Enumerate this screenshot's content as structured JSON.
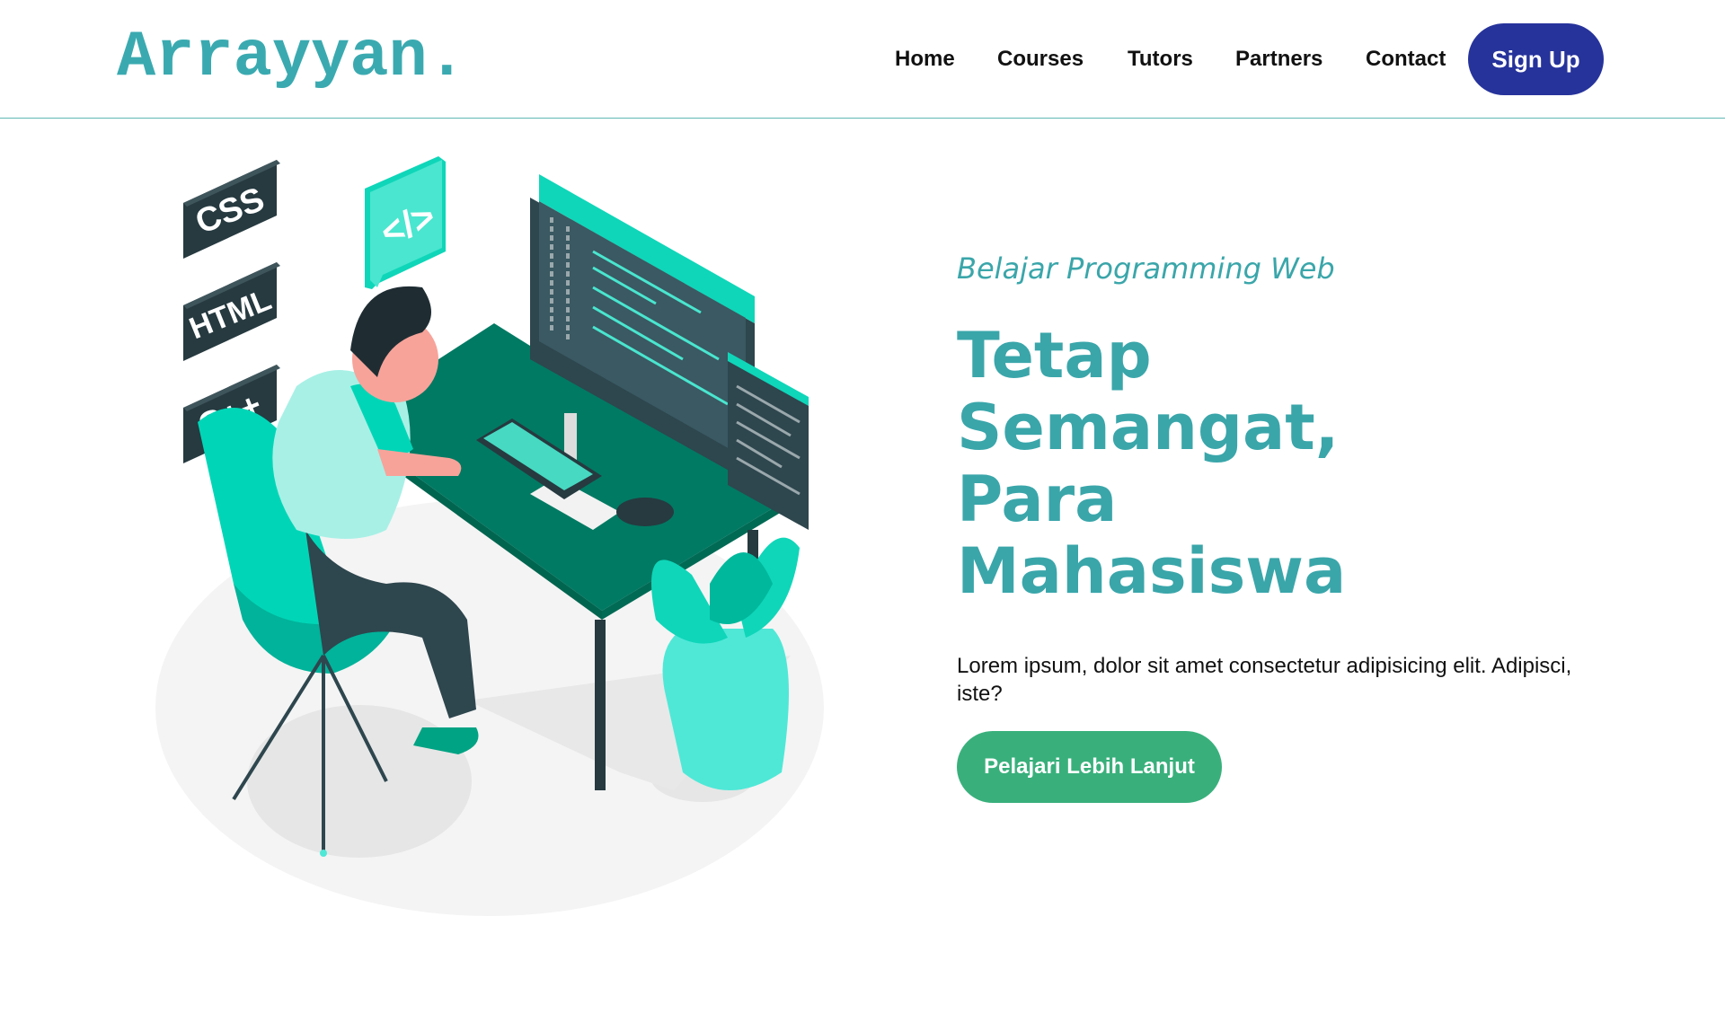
{
  "brand": {
    "logo": "Arrayyan."
  },
  "nav": {
    "items": [
      "Home",
      "Courses",
      "Tutors",
      "Partners",
      "Contact"
    ],
    "signup_label": "Sign Up"
  },
  "hero": {
    "subtitle": "Belajar Programming Web",
    "headline_line1": "Tetap Semangat,",
    "headline_line2": "Para Mahasiswa",
    "description": "Lorem ipsum, dolor sit amet consectetur adipisicing elit. Adipisci, iste?",
    "cta_label": "Pelajari Lebih Lanjut",
    "illustration": {
      "badges": [
        "CSS",
        "HTML",
        "C++"
      ],
      "code_bubble": "</>"
    }
  },
  "colors": {
    "brand": "#3aaab0",
    "signup": "#26339b",
    "cta": "#39b07c",
    "accent_teal": "#0fd6b9"
  }
}
